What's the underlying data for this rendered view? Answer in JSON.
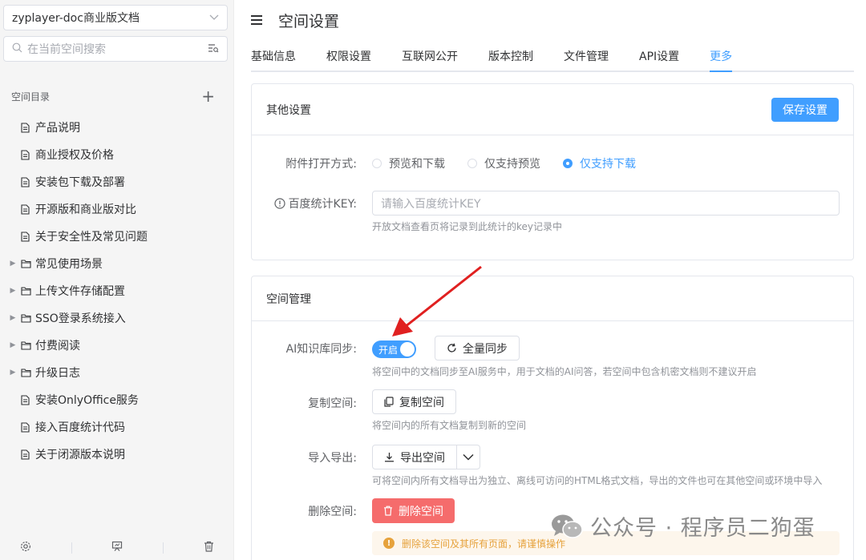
{
  "sidebar": {
    "space_name": "zyplayer-doc商业版文档",
    "search_placeholder": "在当前空间搜索",
    "dir_title": "空间目录",
    "items": [
      {
        "label": "产品说明",
        "folder": false
      },
      {
        "label": "商业授权及价格",
        "folder": false
      },
      {
        "label": "安装包下载及部署",
        "folder": false
      },
      {
        "label": "开源版和商业版对比",
        "folder": false
      },
      {
        "label": "关于安全性及常见问题",
        "folder": false
      },
      {
        "label": "常见使用场景",
        "folder": true
      },
      {
        "label": "上传文件存储配置",
        "folder": true
      },
      {
        "label": "SSO登录系统接入",
        "folder": true
      },
      {
        "label": "付费阅读",
        "folder": true
      },
      {
        "label": "升级日志",
        "folder": true
      },
      {
        "label": "安装OnlyOffice服务",
        "folder": false
      },
      {
        "label": "接入百度统计代码",
        "folder": false
      },
      {
        "label": "关于闭源版本说明",
        "folder": false
      }
    ]
  },
  "header": {
    "title": "空间设置"
  },
  "tabs": [
    "基础信息",
    "权限设置",
    "互联网公开",
    "版本控制",
    "文件管理",
    "API设置",
    "更多"
  ],
  "active_tab": "更多",
  "other_settings": {
    "title": "其他设置",
    "save_label": "保存设置",
    "attach_label": "附件打开方式:",
    "attach_options": [
      "预览和下载",
      "仅支持预览",
      "仅支持下载"
    ],
    "attach_selected": "仅支持下载",
    "baidu_label": "百度统计KEY:",
    "baidu_placeholder": "请输入百度统计KEY",
    "baidu_hint": "开放文档查看页将记录到此统计的key记录中"
  },
  "space_mgmt": {
    "title": "空间管理",
    "ai_label": "AI知识库同步:",
    "ai_switch_text": "开启",
    "ai_switch_on": true,
    "full_sync_label": "全量同步",
    "ai_hint": "将空间中的文档同步至AI服务中，用于文档的AI问答，若空间中包含机密文档则不建议开启",
    "copy_label": "复制空间:",
    "copy_btn": "复制空间",
    "copy_hint": "将空间内的所有文档复制到新的空间",
    "export_label": "导入导出:",
    "export_btn": "导出空间",
    "export_hint": "可将空间内所有文档导出为独立、离线可访问的HTML格式文档，导出的文件也可在其他空间或环境中导入",
    "delete_label": "删除空间:",
    "delete_btn": "删除空间",
    "delete_warn": "删除该空间及其所有页面，请谨慎操作"
  },
  "watermark": "公众号 · 程序员二狗蛋",
  "colors": {
    "primary": "#409eff",
    "danger": "#f56c6c",
    "warning": "#e6a23c",
    "arrow": "#e02020"
  }
}
